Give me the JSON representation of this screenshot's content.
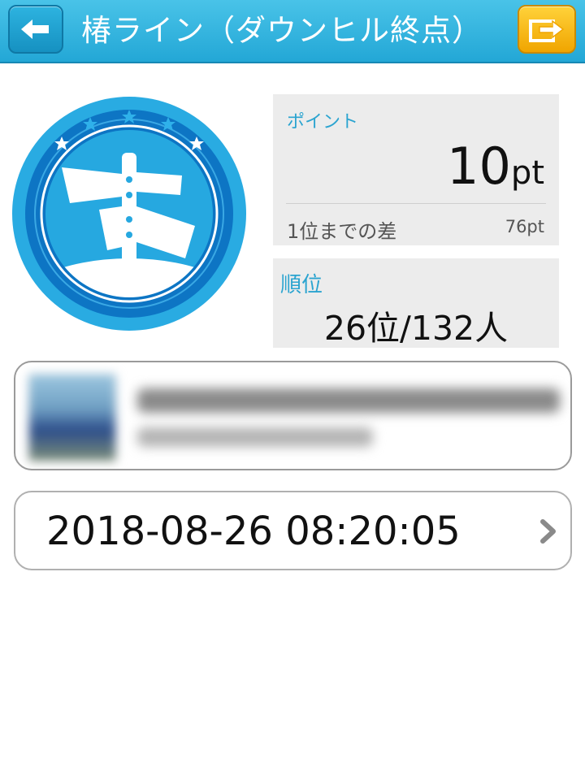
{
  "header": {
    "title": "椿ライン（ダウンヒル終点）",
    "back_icon": "arrow-left-icon",
    "share_icon": "share-icon"
  },
  "badge": {
    "icon": "signpost-badge-icon",
    "colors": {
      "outer": "#29abe2",
      "ring": "#0d75c4",
      "inner": "#26a8e0"
    }
  },
  "points": {
    "label": "ポイント",
    "value": "10",
    "unit": "pt",
    "gap_label": "1位までの差",
    "gap_value": "76pt"
  },
  "rank": {
    "label": "順位",
    "value": "26位/132人"
  },
  "date_row": {
    "datetime": "2018-08-26 08:20:05",
    "chevron_icon": "chevron-right-icon"
  },
  "colors": {
    "header": "#2db3e0",
    "accent_text": "#2ba4d0",
    "share_button": "#f5b400",
    "panel_bg": "#ececec"
  }
}
